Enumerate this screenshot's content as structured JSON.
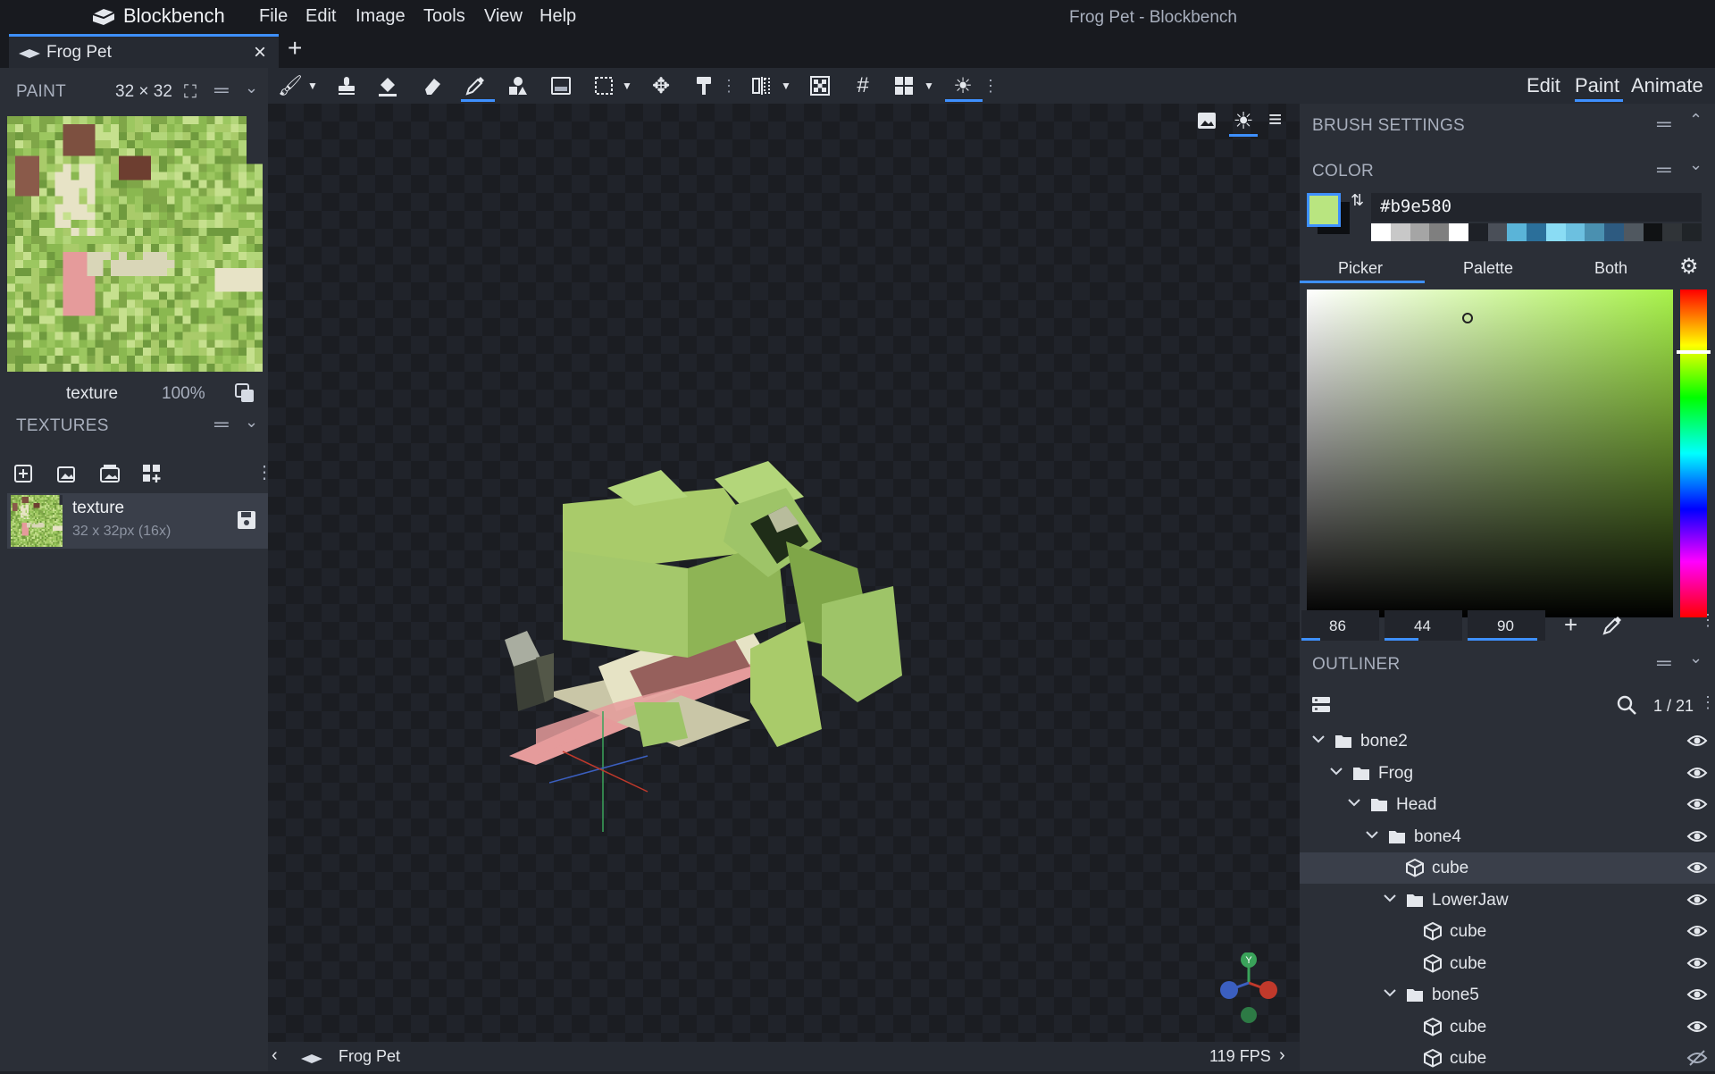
{
  "app": {
    "name": "Blockbench",
    "window_title": "Frog Pet - Blockbench"
  },
  "menu": [
    "File",
    "Edit",
    "Image",
    "Tools",
    "View",
    "Help"
  ],
  "project_tab": {
    "label": "Frog Pet"
  },
  "modes": [
    "Edit",
    "Paint",
    "Animate"
  ],
  "active_mode": "Paint",
  "paint": {
    "title": "PAINT",
    "size": "32 × 32",
    "texture_name": "texture",
    "zoom": "100%"
  },
  "textures": {
    "title": "TEXTURES",
    "items": [
      {
        "name": "texture",
        "meta": "32 x 32px (16x)"
      }
    ]
  },
  "brush": {
    "title": "BRUSH SETTINGS"
  },
  "color": {
    "title": "COLOR",
    "hex": "#b9e580",
    "tabs": [
      "Picker",
      "Palette",
      "Both"
    ],
    "active_tab": "Picker",
    "values": [
      "86",
      "44",
      "90"
    ],
    "value_fill": [
      0.24,
      0.44,
      0.9
    ],
    "palette": [
      "#ffffff",
      "#c8c8c8",
      "#a5a5a5",
      "#7f7f7f",
      "#ffffff",
      "#1e2127",
      "#4a4f58",
      "#5ab4d8",
      "#2b6f9a",
      "#8adcf4",
      "#6cc0e0",
      "#4a90b0",
      "#2d5a80",
      "#505860",
      "#101214",
      "#303438",
      "#202428"
    ]
  },
  "outliner": {
    "title": "OUTLINER",
    "count": "1 / 21",
    "nodes": [
      {
        "label": "bone2",
        "type": "folder",
        "depth": 0
      },
      {
        "label": "Frog",
        "type": "folder",
        "depth": 1
      },
      {
        "label": "Head",
        "type": "folder",
        "depth": 2
      },
      {
        "label": "bone4",
        "type": "folder",
        "depth": 3
      },
      {
        "label": "cube",
        "type": "cube",
        "depth": 4,
        "selected": true
      },
      {
        "label": "LowerJaw",
        "type": "folder",
        "depth": 4
      },
      {
        "label": "cube",
        "type": "cube",
        "depth": 5
      },
      {
        "label": "cube",
        "type": "cube",
        "depth": 5
      },
      {
        "label": "bone5",
        "type": "folder",
        "depth": 4
      },
      {
        "label": "cube",
        "type": "cube",
        "depth": 5
      },
      {
        "label": "cube",
        "type": "cube",
        "depth": 5,
        "hidden": true
      }
    ]
  },
  "status": {
    "project": "Frog Pet",
    "fps": "119 FPS"
  },
  "gizmo": {
    "label": "Y"
  },
  "colors": {
    "accent": "#3e90ff",
    "selected_color": "#b9e580"
  }
}
